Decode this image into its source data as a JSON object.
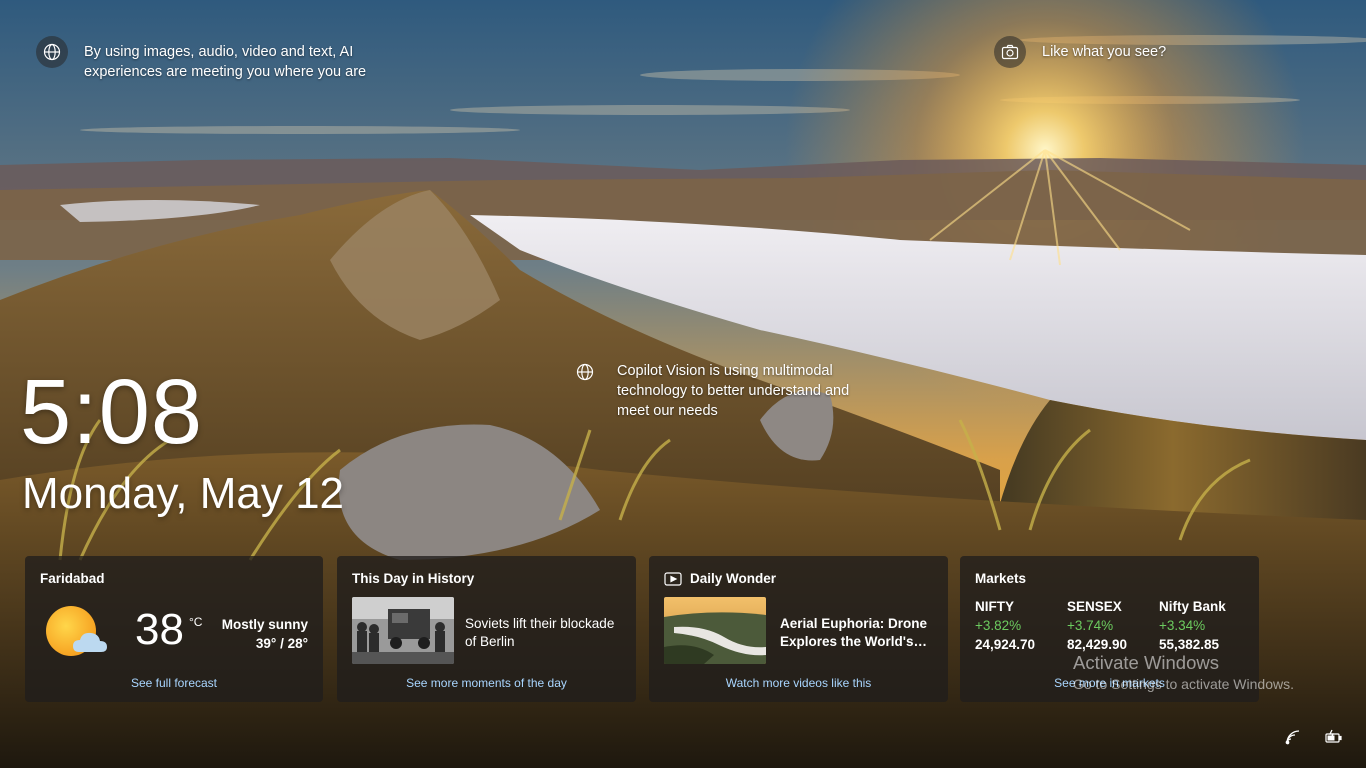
{
  "hints": {
    "ai": "By using images, audio, video and text, AI experiences are meeting you where you are",
    "camera": "Like what you see?",
    "copilot": "Copilot Vision is using multimodal technology to better understand and meet our needs"
  },
  "clock": {
    "time": "5:08",
    "date": "Monday, May 12"
  },
  "widgets": {
    "weather": {
      "title": "Faridabad",
      "temp": "38",
      "unit": "°C",
      "condition": "Mostly sunny",
      "range": "39° / 28°",
      "link": "See full forecast",
      "icon": "partly-sunny-icon"
    },
    "history": {
      "title": "This Day in History",
      "text": "Soviets lift their blockade of Berlin",
      "link": "See more moments of the day"
    },
    "wonder": {
      "title": "Daily Wonder",
      "text": "Aerial Euphoria: Drone Explores the World's…",
      "link": "Watch more videos like this",
      "icon": "video-icon"
    },
    "markets": {
      "title": "Markets",
      "items": [
        {
          "name": "NIFTY",
          "change": "+3.82%",
          "value": "24,924.70"
        },
        {
          "name": "SENSEX",
          "change": "+3.74%",
          "value": "82,429.90"
        },
        {
          "name": "Nifty Bank",
          "change": "+3.34%",
          "value": "55,382.85"
        }
      ],
      "link": "See more in markets"
    }
  },
  "watermark": {
    "title": "Activate Windows",
    "subtitle": "Go to Settings to activate Windows."
  },
  "tray": {
    "network_icon": "wifi-icon",
    "battery_icon": "battery-charging-icon"
  },
  "colors": {
    "positive": "#6ccb5f",
    "link": "#a9d6ff",
    "card_bg": "rgba(32,30,28,0.78)"
  }
}
